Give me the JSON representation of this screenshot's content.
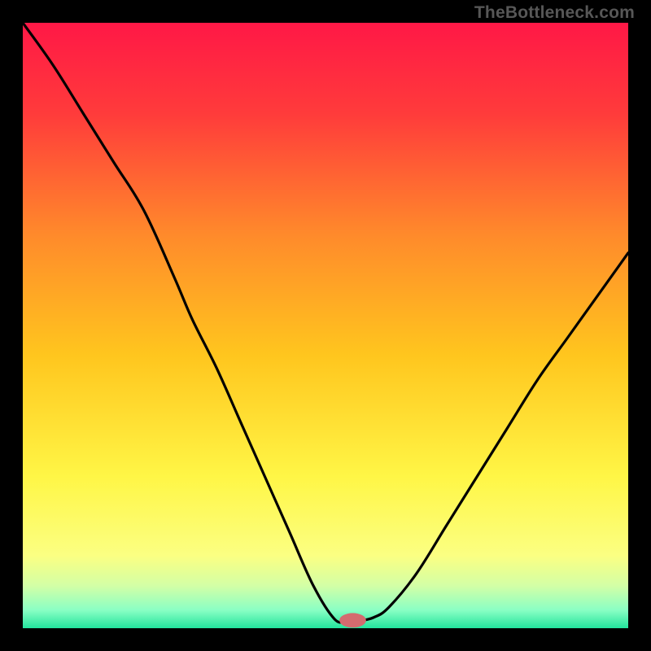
{
  "attribution": "TheBottleneck.com",
  "chart_data": {
    "type": "line",
    "title": "",
    "xlabel": "",
    "ylabel": "",
    "xlim": [
      0,
      100
    ],
    "ylim": [
      0,
      100
    ],
    "grid": false,
    "legend": false,
    "background_gradient": [
      {
        "pos": 0.0,
        "color": "#ff1846"
      },
      {
        "pos": 0.15,
        "color": "#ff3b3b"
      },
      {
        "pos": 0.35,
        "color": "#ff8a2b"
      },
      {
        "pos": 0.55,
        "color": "#ffc61e"
      },
      {
        "pos": 0.75,
        "color": "#fff646"
      },
      {
        "pos": 0.88,
        "color": "#fbff82"
      },
      {
        "pos": 0.93,
        "color": "#d3ffa6"
      },
      {
        "pos": 0.97,
        "color": "#8affc4"
      },
      {
        "pos": 1.0,
        "color": "#23e49d"
      }
    ],
    "series": [
      {
        "name": "curve",
        "color": "#000000",
        "x": [
          0,
          5,
          10,
          15,
          20,
          25,
          28,
          32,
          36,
          40,
          44,
          48,
          51.5,
          53.5,
          55.5,
          58,
          60.5,
          65,
          70,
          75,
          80,
          85,
          90,
          95,
          100
        ],
        "y": [
          100,
          93,
          85,
          77,
          69,
          58,
          51,
          43,
          34,
          25,
          16,
          7,
          1.5,
          1.2,
          1.2,
          1.8,
          3.5,
          9,
          17,
          25,
          33,
          41,
          48,
          55,
          62
        ]
      }
    ],
    "markers": [
      {
        "name": "minimum-marker",
        "x": 54.5,
        "y": 1.3,
        "rx": 2.2,
        "ry": 1.2,
        "color": "#d46b6f"
      }
    ]
  }
}
